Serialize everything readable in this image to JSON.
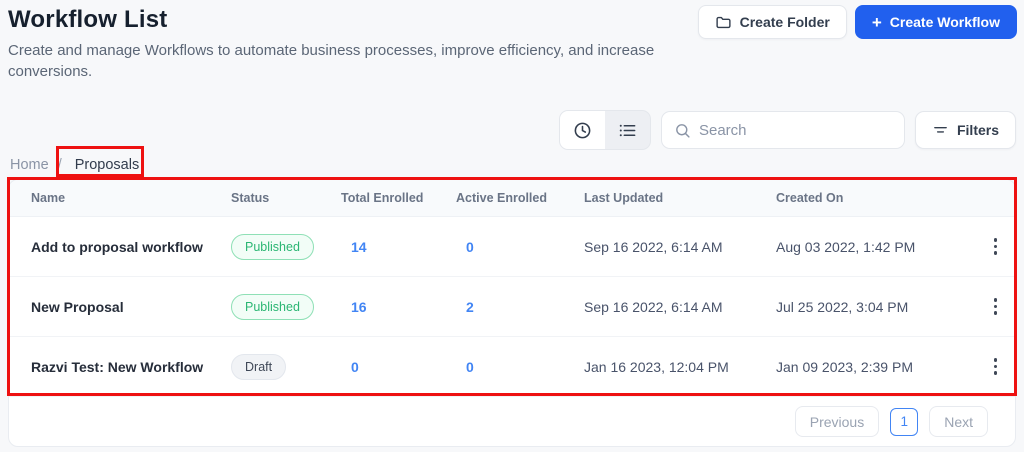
{
  "page": {
    "title": "Workflow List",
    "subtitle": "Create and manage Workflows to automate business processes, improve efficiency, and increase conversions."
  },
  "actions": {
    "create_folder_label": "Create Folder",
    "plus_icon": "+",
    "create_workflow_label": "Create Workflow"
  },
  "toolbar": {
    "search_placeholder": "Search",
    "filters_label": "Filters"
  },
  "breadcrumb": {
    "home": "Home",
    "separator": "/",
    "current": "Proposals"
  },
  "table": {
    "columns": [
      "Name",
      "Status",
      "Total Enrolled",
      "Active Enrolled",
      "Last Updated",
      "Created On"
    ],
    "rows": [
      {
        "name": "Add to proposal workflow",
        "status": "Published",
        "total_enrolled": "14",
        "active_enrolled": "0",
        "last_updated": "Sep 16 2022, 6:14 AM",
        "created_on": "Aug 03 2022, 1:42 PM"
      },
      {
        "name": "New Proposal",
        "status": "Published",
        "total_enrolled": "16",
        "active_enrolled": "2",
        "last_updated": "Sep 16 2022, 6:14 AM",
        "created_on": "Jul 25 2022, 3:04 PM"
      },
      {
        "name": "Razvi Test: New Workflow",
        "status": "Draft",
        "total_enrolled": "0",
        "active_enrolled": "0",
        "last_updated": "Jan 16 2023, 12:04 PM",
        "created_on": "Jan 09 2023, 2:39 PM"
      }
    ]
  },
  "pagination": {
    "previous": "Previous",
    "page": "1",
    "next": "Next"
  },
  "colors": {
    "primary_blue": "#2160ee",
    "link_blue": "#4285f4",
    "published_green": "#2bb673",
    "annotation_red": "#ee1111"
  }
}
